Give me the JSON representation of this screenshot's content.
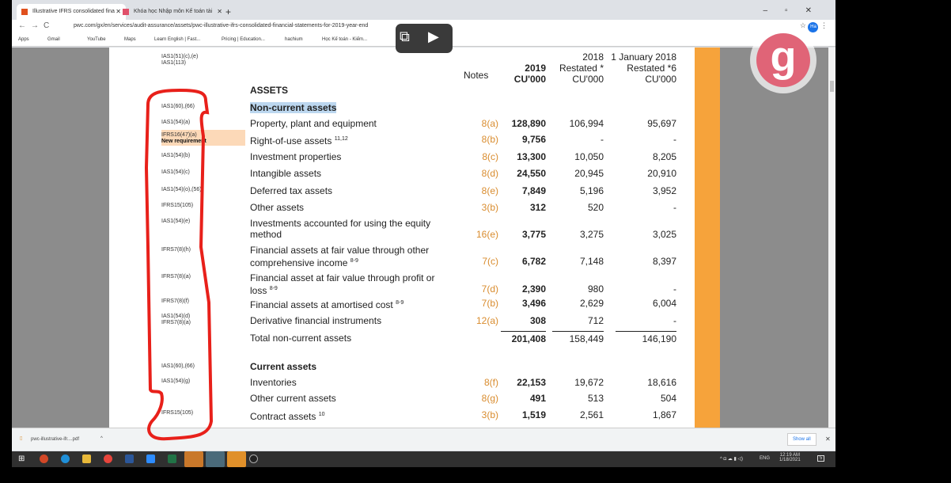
{
  "browser": {
    "tabs": [
      {
        "title": "Illustrative IFRS consolidated fina",
        "active": true
      },
      {
        "title": "Khóa học Nhập môn Kế toán tài",
        "active": false
      }
    ],
    "url": "pwc.com/gx/en/services/audit-assurance/assets/pwc-illustrative-ifrs-consolidated-financial-statements-for-2019-year-end",
    "profile": "Ha",
    "bookmarks": [
      "Apps",
      "Gmail",
      "YouTube",
      "Maps",
      "Learn English | Fast...",
      "Pricing | Education...",
      "hachium",
      "Học Kế toán - Kiếm..."
    ]
  },
  "table": {
    "header": {
      "ref1": "IAS1(51)(c),(e)",
      "ref2": "IAS1(113)",
      "notes": "Notes",
      "y2019": "2019",
      "y2018": "2018",
      "jan2018": "1 January 2018",
      "restated": "Restated *",
      "restated6": "Restated *6",
      "cu1": "CU'000",
      "cu2": "CU'000",
      "cu3": "CU'000"
    },
    "assets_heading": "ASSETS",
    "rows": [
      {
        "ref": "IAS1(60),(66)",
        "label": "Non-current assets",
        "kind": "section"
      },
      {
        "ref": "IAS1(54)(a)",
        "label": "Property, plant and equipment",
        "note": "8(a)",
        "v2019": "128,890",
        "v2018": "106,994",
        "v2017": "95,697"
      },
      {
        "ref": "IFRS16(47)(a)",
        "ref_extra": "New requirement",
        "label": "Right-of-use assets",
        "sup": "11,12",
        "note": "8(b)",
        "v2019": "9,756",
        "v2018": "-",
        "v2017": "-"
      },
      {
        "ref": "IAS1(54)(b)",
        "label": "Investment properties",
        "note": "8(c)",
        "v2019": "13,300",
        "v2018": "10,050",
        "v2017": "8,205"
      },
      {
        "ref": "IAS1(54)(c)",
        "label": "Intangible assets",
        "note": "8(d)",
        "v2019": "24,550",
        "v2018": "20,945",
        "v2017": "20,910"
      },
      {
        "ref": "IAS1(54)(o),(56)",
        "label": "Deferred tax assets",
        "note": "8(e)",
        "v2019": "7,849",
        "v2018": "5,196",
        "v2017": "3,952"
      },
      {
        "ref": "IFRS15(105)",
        "label": "Other assets",
        "note": "3(b)",
        "v2019": "312",
        "v2018": "520",
        "v2017": "-"
      },
      {
        "ref": "IAS1(54)(e)",
        "label": "Investments accounted for using the equity method",
        "note": "16(e)",
        "v2019": "3,775",
        "v2018": "3,275",
        "v2017": "3,025"
      },
      {
        "ref": "IFRS7(8)(h)",
        "label": "Financial assets at fair value through other comprehensive income",
        "sup": "8-9",
        "note": "7(c)",
        "v2019": "6,782",
        "v2018": "7,148",
        "v2017": "8,397"
      },
      {
        "ref": "IFRS7(8)(a)",
        "label": "Financial asset at fair value through profit or loss",
        "sup": "8-9",
        "note": "7(d)",
        "v2019": "2,390",
        "v2018": "980",
        "v2017": "-"
      },
      {
        "ref": "IFRS7(8)(f)",
        "label": "Financial assets at amortised cost",
        "sup": "8-9",
        "note": "7(b)",
        "v2019": "3,496",
        "v2018": "2,629",
        "v2017": "6,004"
      },
      {
        "ref": "IAS1(54)(d)",
        "ref2": "IFRS7(8)(a)",
        "label": "Derivative financial instruments",
        "note": "12(a)",
        "v2019": "308",
        "v2018": "712",
        "v2017": "-"
      },
      {
        "label": "Total non-current assets",
        "v2019": "201,408",
        "v2018": "158,449",
        "v2017": "146,190",
        "kind": "total"
      },
      {
        "ref": "IAS1(60),(66)",
        "label": "Current assets",
        "kind": "section"
      },
      {
        "ref": "IAS1(54)(g)",
        "label": "Inventories",
        "note": "8(f)",
        "v2019": "22,153",
        "v2018": "19,672",
        "v2017": "18,616"
      },
      {
        "label": "Other current assets",
        "note": "8(g)",
        "v2019": "491",
        "v2018": "513",
        "v2017": "504"
      },
      {
        "ref": "IFRS15(105)",
        "label": "Contract assets",
        "sup": "10",
        "note": "3(b)",
        "v2019": "1,519",
        "v2018": "2,561",
        "v2017": "1,867"
      }
    ]
  },
  "download": {
    "file": "pwc-illustrative-ifr....pdf",
    "show_all": "Show all"
  },
  "taskbar": {
    "time": "12:19 AM",
    "date": "1/18/2021",
    "lang": "ENG",
    "notif": "5"
  },
  "logo": {
    "letter": "g"
  }
}
